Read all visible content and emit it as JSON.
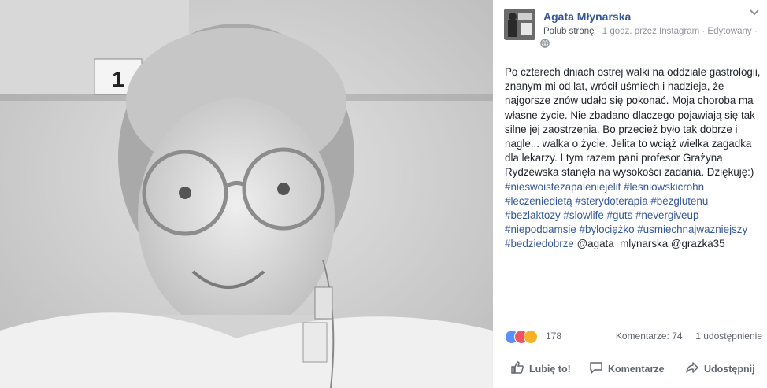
{
  "post": {
    "page_name": "Agata Młynarska",
    "like_page": "Polub stronę",
    "meta": "· 1 godz. przez Instagram · Edytowany ·",
    "body": "Po czterech dniach ostrej walki na oddziale gastrologii, znanym mi od lat, wrócił uśmiech i nadzieja, że najgorsze znów udało się pokonać. Moja choroba ma własne życie. Nie zbadano dlaczego pojawiają się tak silne jej zaostrzenia. Bo przecież było tak dobrze i nagle... walka o życie. Jelita to wciąż wielka zagadka dla lekarzy. I tym razem pani profesor Grażyna Rydzewska stanęła na wysokości zadania. Dziękuję:)",
    "hashtags": "#nieswoistezapaleniejelit #lesniowskicrohn #leczeniedietą #sterydoterapia #bezglutenu #bezlaktozy #slowlife #guts #nevergiveup #niepoddamsie #bylociężko #usmiechnajwazniejszy #bedziedobrze",
    "mentions": "@agata_mlynarska @grazka35",
    "reaction_count": "178",
    "comments": "Komentarze: 74",
    "shares": "1 udostępnienie",
    "photo_sign": "1"
  },
  "actions": {
    "like": "Lubię to!",
    "comment": "Komentarze",
    "share": "Udostępnij"
  },
  "icons": [
    "globe-icon",
    "chevron-down-icon",
    "like-reaction-icon",
    "love-reaction-icon",
    "sad-reaction-icon",
    "thumbs-up-icon",
    "comment-icon",
    "share-icon"
  ],
  "colors": {
    "link": "#365899",
    "meta": "#90949c",
    "like_blue": "#5890ff",
    "love_red": "#f25268",
    "sad_yellow": "#f7b125"
  }
}
